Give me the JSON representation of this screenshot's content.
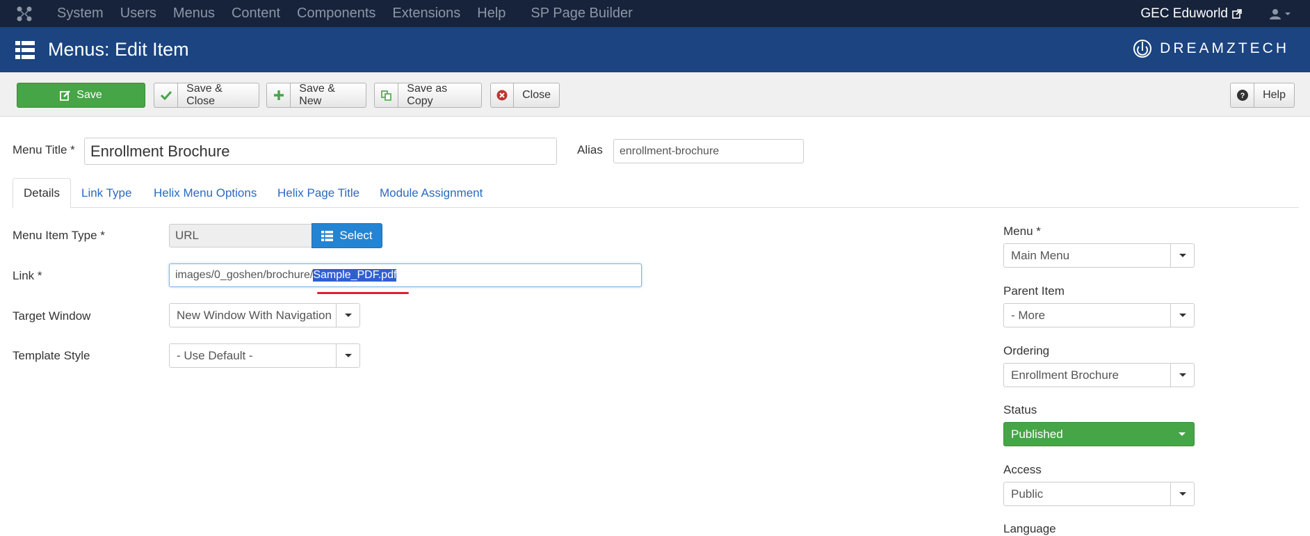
{
  "topnav": {
    "items": [
      "System",
      "Users",
      "Menus",
      "Content",
      "Components",
      "Extensions",
      "Help"
    ],
    "page_builder": "SP Page Builder",
    "site_name": "GEC Eduworld"
  },
  "header": {
    "title": "Menus: Edit Item",
    "brand": "DREAMZTECH"
  },
  "toolbar": {
    "save": "Save",
    "save_close": "Save & Close",
    "save_new": "Save & New",
    "save_copy": "Save as Copy",
    "close": "Close",
    "help": "Help"
  },
  "form": {
    "menu_title_label": "Menu Title *",
    "menu_title_value": "Enrollment Brochure",
    "alias_label": "Alias",
    "alias_value": "enrollment-brochure",
    "tabs": [
      "Details",
      "Link Type",
      "Helix Menu Options",
      "Helix Page Title",
      "Module Assignment"
    ],
    "menu_item_type_label": "Menu Item Type *",
    "menu_item_type_value": "URL",
    "select_button": "Select",
    "link_label": "Link *",
    "link_prefix": "images/0_goshen/brochure/",
    "link_selected": "Sample_PDF.pdf",
    "target_window_label": "Target Window",
    "target_window_value": "New Window With Navigation",
    "template_style_label": "Template Style",
    "template_style_value": "- Use Default -"
  },
  "sidebar": {
    "menu_label": "Menu *",
    "menu_value": "Main Menu",
    "parent_label": "Parent Item",
    "parent_value": "- More",
    "ordering_label": "Ordering",
    "ordering_value": "Enrollment Brochure",
    "status_label": "Status",
    "status_value": "Published",
    "access_label": "Access",
    "access_value": "Public",
    "language_label": "Language"
  },
  "colors": {
    "topnav_bg": "#17233a",
    "header_bg": "#1b4480",
    "save_green": "#46a546",
    "select_blue": "#2384d3",
    "status_green": "#46a546",
    "annotation_red": "#d9232d"
  }
}
